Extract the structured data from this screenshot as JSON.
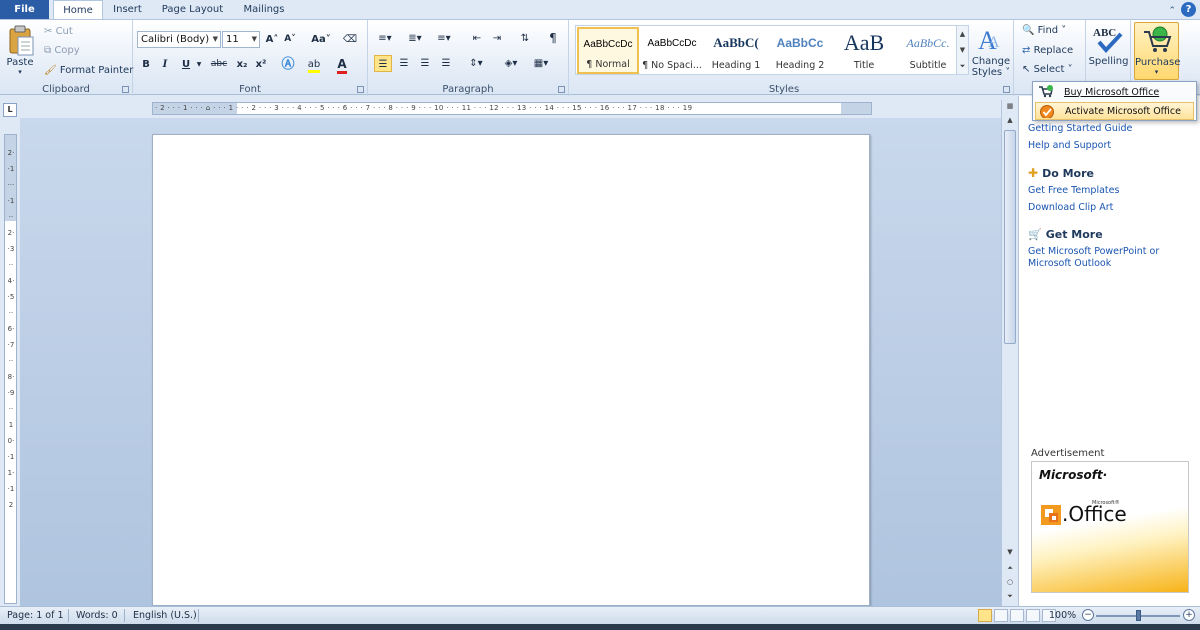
{
  "tabs": {
    "file": "File",
    "items": [
      "Home",
      "Insert",
      "Page Layout",
      "Mailings"
    ],
    "help": "?"
  },
  "clipboard": {
    "paste": "Paste",
    "cut": "Cut",
    "copy": "Copy",
    "format_painter": "Format Painter",
    "label": "Clipboard"
  },
  "font": {
    "family": "Calibri (Body)",
    "size": "11",
    "grow": "A˄",
    "shrink": "A˅",
    "change_case": "Aa˅",
    "bold": "B",
    "italic": "I",
    "underline": "U",
    "strike": "abc",
    "subscript": "x₂",
    "superscript": "x²",
    "color_a": "A",
    "label": "Font"
  },
  "paragraph": {
    "pilcrow": "¶",
    "label": "Paragraph"
  },
  "styles": {
    "items": [
      {
        "preview": "AaBbCcDc",
        "name": "¶ Normal"
      },
      {
        "preview": "AaBbCcDc",
        "name": "¶ No Spaci..."
      },
      {
        "preview": "AaBbC(",
        "name": "Heading 1"
      },
      {
        "preview": "AaBbCc",
        "name": "Heading 2"
      },
      {
        "preview": "AaB",
        "name": "Title"
      },
      {
        "preview": "AaBbCc.",
        "name": "Subtitle"
      }
    ],
    "change_styles": [
      "Change",
      "Styles ˅"
    ],
    "label": "Styles"
  },
  "editing": {
    "find": "Find ˅",
    "replace": "Replace",
    "select": "Select ˅"
  },
  "proofing": {
    "spelling": "Spelling",
    "spelling_icon_text": "ABC"
  },
  "purchase": {
    "label": "Purchase"
  },
  "purchase_menu": {
    "buy": "Buy Microsoft Office",
    "activate": "Activate Microsoft Office"
  },
  "ruler": {
    "h_marks": "· 2 · · · 1 · · · ⌂ · · · 1 · · · 2 · · · 3 · · · 4 · · · 5 · · · 6 · · · 7 · · · 8 · · · 9 · · · 10 · · · 11 · · · 12 · · · 13 · · · 14 · · · 15 · · · 16 · · · 17 · · · 18 · · · 19",
    "v_marks": "2··1····1··2··3··4··5··6··7··8··9··10··11··12",
    "corner": "L"
  },
  "pane": {
    "links_top": [
      "Getting Started Guide",
      "Help and Support"
    ],
    "do_more": {
      "title": "Do More",
      "links": [
        "Get Free Templates",
        "Download Clip Art"
      ]
    },
    "get_more": {
      "title": "Get More",
      "link": "Get Microsoft PowerPoint or Microsoft Outlook"
    },
    "ad_label": "Advertisement",
    "ad": {
      "brand": "Microsoft·",
      "sup": "Microsoft®",
      "product": ".Office"
    }
  },
  "status": {
    "page": "Page: 1 of 1",
    "words": "Words: 0",
    "language": "English (U.S.)",
    "zoom": "100%",
    "zoom_level": 1.0
  },
  "colors": {
    "file_tab": "#2a5da5",
    "link": "#1a55b0",
    "highlight": "#ffe29a",
    "selected_style_border": "#f0c050"
  }
}
